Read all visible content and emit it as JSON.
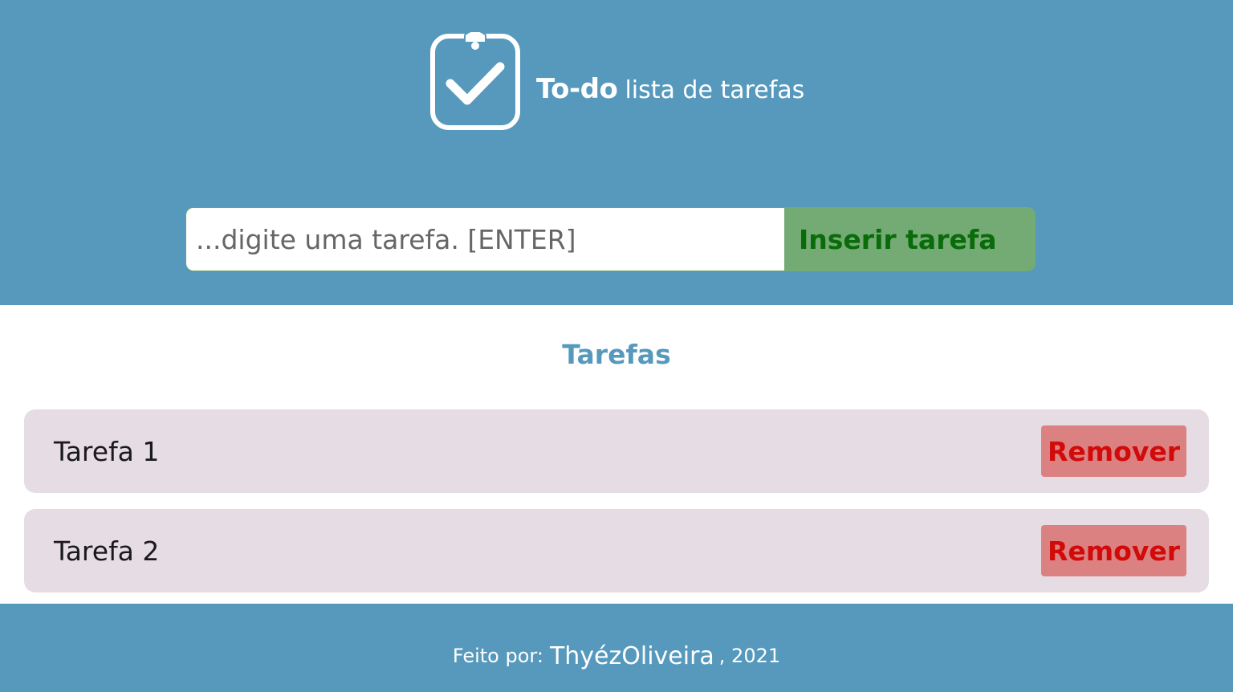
{
  "header": {
    "brand_strong": "To-do",
    "brand_light": "lista de tarefas",
    "logo_icon": "clipboard-check-icon"
  },
  "form": {
    "input_placeholder": "...digite uma tarefa. [ENTER]",
    "input_value": "",
    "submit_label": "Inserir tarefa"
  },
  "tasks_section": {
    "title": "Tarefas",
    "items": [
      {
        "label": "Tarefa 1",
        "remove_label": "Remover"
      },
      {
        "label": "Tarefa 2",
        "remove_label": "Remover"
      }
    ]
  },
  "footer": {
    "prefix": "Feito por:",
    "author": "ThyézOliveira",
    "year": ", 2021"
  },
  "colors": {
    "primary": "#5699bd",
    "insert_bg": "#74ab74",
    "insert_text": "#096b09",
    "task_bg": "#e6dce4",
    "remove_bg": "#db8181",
    "remove_text": "#d10a0a"
  }
}
